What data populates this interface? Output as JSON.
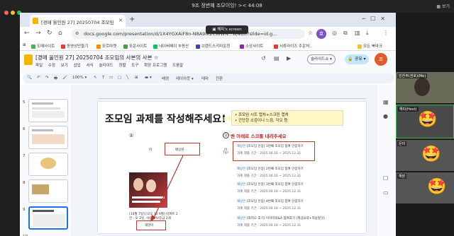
{
  "zoom": {
    "title": "9조 정변혜 조모이잉! >< 44:08",
    "screen_pill": "해피's screen",
    "view_label": "보기"
  },
  "browser": {
    "tab_title": "[경매 올인원 27] 20250704 조모임",
    "url": "docs.google.com/presentation/d/1X4YGXAiF8n-N8A9IK2CWWN...w/edit?slide=id.g...",
    "bookmarks": [
      {
        "label": "도메사이트",
        "color": "#4caf50"
      },
      {
        "label": "동영상만들기",
        "color": "#e53935"
      },
      {
        "label": "모르마켓",
        "color": "#fb8c00"
      },
      {
        "label": "포운사이트",
        "color": "#43a047"
      },
      {
        "label": "네이버페이 부동산",
        "color": "#03c75a"
      },
      {
        "label": "브랜드스키마운칭",
        "color": "#3949ab"
      },
      {
        "label": "소상사이트",
        "color": "#8e24aa"
      },
      {
        "label": "서류라이즈 주운처..",
        "color": "#e53935"
      },
      {
        "label": "모든 북마크",
        "color": "#fbc02d"
      }
    ],
    "profile_initial": "흐"
  },
  "slides": {
    "doc_title": "[경매 올인원 27] 20250704 조모임의 사본의 사본 ☆",
    "menu": [
      "파일",
      "수정",
      "보기",
      "삽입",
      "서식",
      "슬라이드",
      "정렬",
      "도구",
      "확장 프로그램",
      "도움말"
    ],
    "present_label": "슬라이드쇼 ▾",
    "share_label": "🔒 공유 ▾",
    "user_initial": "조",
    "toolbar": [
      "🔍",
      "↶",
      "↷",
      "🖶",
      "🖌",
      "100% ▾",
      "↖",
      "T",
      "▭",
      "▢",
      "╲",
      "⊞",
      "▬ ▾",
      "배경",
      "레이아웃 ▾",
      "테마",
      "전환"
    ],
    "thumb_numbers": [
      "5",
      "6",
      "7",
      "8",
      "9",
      "10"
    ]
  },
  "slide": {
    "title": "조모임 과제를 작성해주세요!",
    "note_lines": [
      "• 조모임 시트 캡쳐+스크린 캡쳐",
      "• 간단한 소감이나 느낌, 각오 등"
    ],
    "step1": "①",
    "step2_num": "②",
    "step2_text": "밴 아래로 스크롤 내리주세요",
    "left_top_labels": [
      "아",
      "배상원",
      "아"
    ],
    "product_caption_1": "[10월 7일] [모모 10 9월] 아파트 2",
    "product_caption_2": "건 - 모 2일, 사람당 보증금 2개",
    "nickname": "해맑아",
    "tag_text": "Tip!",
    "classes": [
      {
        "name": "해상은",
        "title": "[조모임 인증] 1번째 조모임 참여 인증하기",
        "date": "과제 제출 기간 : 2025.04.16 ~ 2025.12.31"
      },
      {
        "name": "해상은",
        "title": "[조모임 인증] 2번째 조모임 참여 인증하기",
        "date": "과제 제출 기간 : 2025.04.16 ~ 2025.12.31"
      },
      {
        "name": "해상은",
        "title": "[조모임 인증] 3번째 조모임 참여 인증하기",
        "date": "과제 제출 기간 : 2025.04.16 ~ 2025.12.31"
      },
      {
        "name": "해상은",
        "title": "[조모임 인증] 4번째 조모임 참여 인증하기",
        "date": "과제 제출 기간 : 2025.04.16 ~ 2025.12.31"
      },
      {
        "name": "해상은",
        "title": "[최지오 후기] 이미미의&A 참여후기 (책상요약+적용할것)",
        "date": "과제 제출 기간 : 2025.04.16 ~ 2025.12.31"
      }
    ]
  },
  "participants": [
    {
      "name": "민찬주(권호)(Me)"
    },
    {
      "name": "해피(Host)"
    },
    {
      "name": "은미"
    },
    {
      "name": "해맑"
    }
  ]
}
